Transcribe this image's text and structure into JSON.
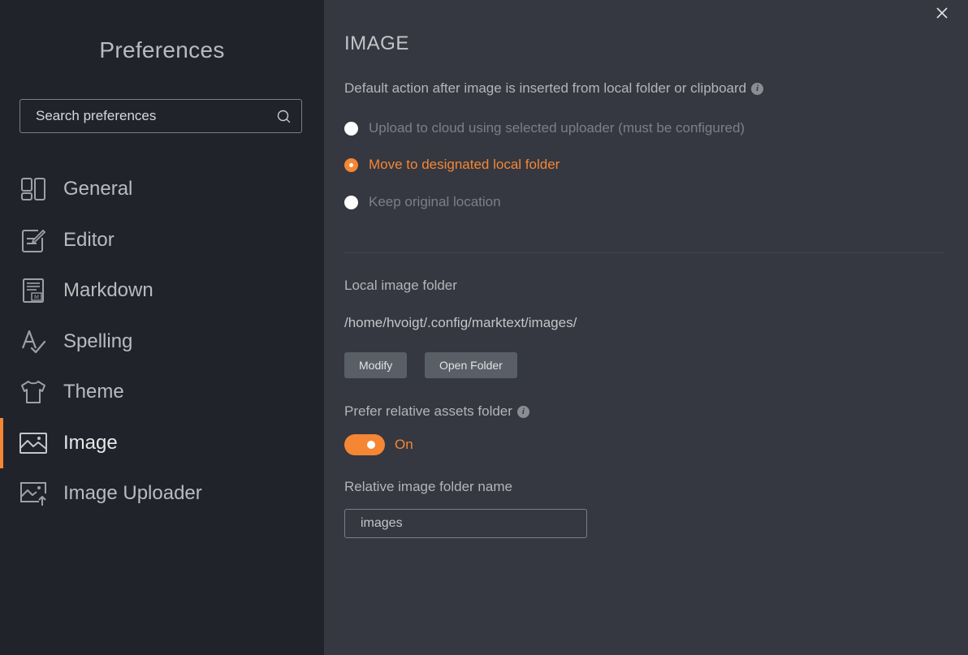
{
  "sidebar": {
    "title": "Preferences",
    "search": {
      "placeholder": "Search preferences",
      "value": ""
    },
    "items": [
      {
        "label": "General",
        "icon": "general-icon",
        "active": false
      },
      {
        "label": "Editor",
        "icon": "editor-icon",
        "active": false
      },
      {
        "label": "Markdown",
        "icon": "markdown-icon",
        "active": false
      },
      {
        "label": "Spelling",
        "icon": "spelling-icon",
        "active": false
      },
      {
        "label": "Theme",
        "icon": "theme-icon",
        "active": false
      },
      {
        "label": "Image",
        "icon": "image-icon",
        "active": true
      },
      {
        "label": "Image Uploader",
        "icon": "image-uploader-icon",
        "active": false
      }
    ]
  },
  "main": {
    "title": "IMAGE",
    "default_action": {
      "label": "Default action after image is inserted from local folder or clipboard",
      "options": [
        {
          "label": "Upload to cloud using selected uploader (must be configured)",
          "checked": false
        },
        {
          "label": "Move to designated local folder",
          "checked": true
        },
        {
          "label": "Keep original location",
          "checked": false
        }
      ]
    },
    "local_folder": {
      "label": "Local image folder",
      "path": "/home/hvoigt/.config/marktext/images/",
      "modify_label": "Modify",
      "open_label": "Open Folder"
    },
    "relative_assets": {
      "label": "Prefer relative assets folder",
      "enabled": true,
      "state_label": "On"
    },
    "relative_folder_name": {
      "label": "Relative image folder name",
      "value": "images"
    }
  },
  "colors": {
    "accent": "#f58634",
    "sidebar_bg": "#202329",
    "main_bg": "#353841"
  }
}
